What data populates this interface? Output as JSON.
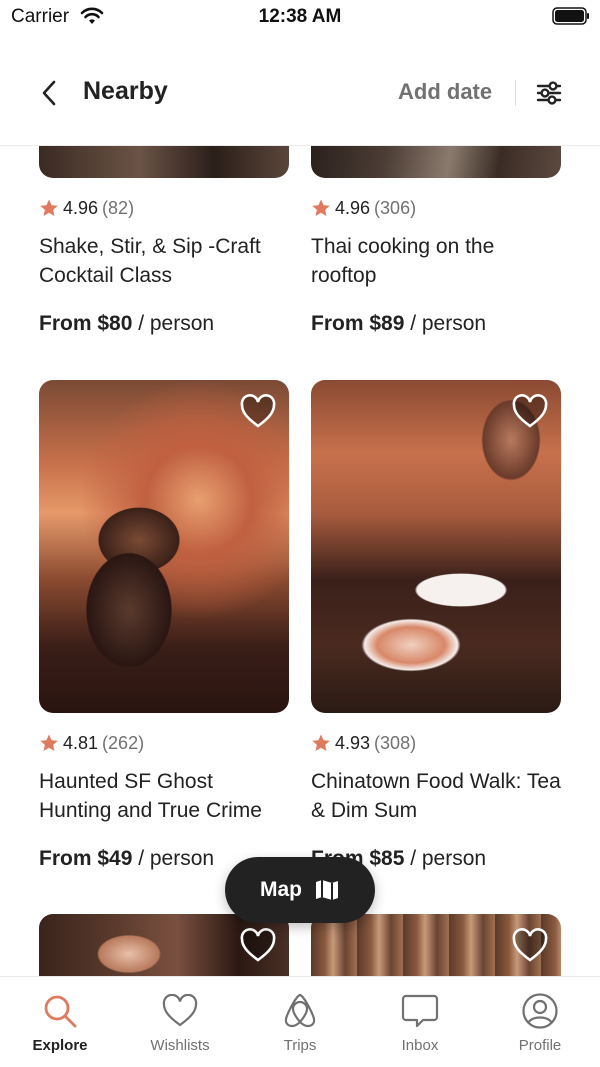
{
  "status_bar": {
    "carrier": "Carrier",
    "time": "12:38 AM"
  },
  "header": {
    "title": "Nearby",
    "add_date": "Add date"
  },
  "colors": {
    "accent": "#e07a5f",
    "star": "#e07a5f",
    "text": "#222222",
    "muted": "#717171",
    "map_button": "#222222"
  },
  "cards": [
    {
      "rating": "4.96",
      "reviews": "(82)",
      "title": "Shake, Stir, & Sip -Craft Cocktail Class",
      "price": "From $80",
      "unit": " / person"
    },
    {
      "rating": "4.96",
      "reviews": "(306)",
      "title": "Thai cooking on the rooftop",
      "price": "From $89",
      "unit": " / person"
    },
    {
      "rating": "4.81",
      "reviews": "(262)",
      "title": "Haunted SF Ghost Hunting and True Crime",
      "price": "From $49",
      "unit": " / person"
    },
    {
      "rating": "4.93",
      "reviews": "(308)",
      "title": "Chinatown Food Walk: Tea & Dim Sum",
      "price": "From $85",
      "unit": " / person"
    }
  ],
  "map_button": {
    "label": "Map",
    "icon": "map-icon"
  },
  "tabbar": {
    "tabs": [
      {
        "label": "Explore",
        "icon": "search-icon",
        "active": true
      },
      {
        "label": "Wishlists",
        "icon": "heart-icon",
        "active": false
      },
      {
        "label": "Trips",
        "icon": "airbnb-logo-icon",
        "active": false
      },
      {
        "label": "Inbox",
        "icon": "message-icon",
        "active": false
      },
      {
        "label": "Profile",
        "icon": "user-icon",
        "active": false
      }
    ]
  }
}
